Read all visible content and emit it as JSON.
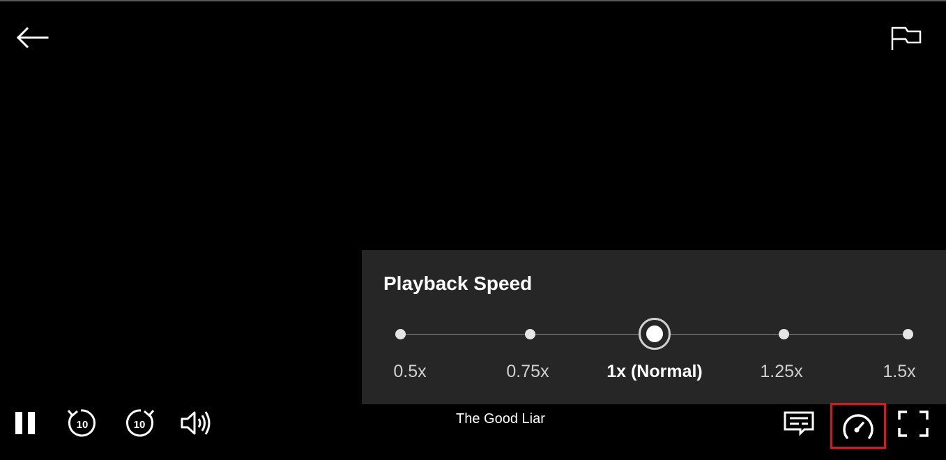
{
  "player": {
    "title": "The Good Liar"
  },
  "top_bar": {
    "back_icon": "arrow-left-icon",
    "report_icon": "flag-icon"
  },
  "speed_panel": {
    "title": "Playback Speed",
    "options": [
      {
        "label": "0.5x",
        "selected": false
      },
      {
        "label": "0.75x",
        "selected": false
      },
      {
        "label": "1x (Normal)",
        "selected": true
      },
      {
        "label": "1.25x",
        "selected": false
      },
      {
        "label": "1.5x",
        "selected": false
      }
    ]
  },
  "controls": {
    "pause_icon": "pause-icon",
    "rewind_icon": "rewind-10-icon",
    "rewind_seconds": "10",
    "forward_icon": "forward-10-icon",
    "forward_seconds": "10",
    "volume_icon": "volume-icon",
    "subtitles_icon": "subtitles-icon",
    "speed_icon": "speedometer-icon",
    "fullscreen_icon": "fullscreen-icon"
  },
  "colors": {
    "background": "#000000",
    "panel_background": "#262626",
    "highlight_border": "#e0141f",
    "text": "#ffffff",
    "muted_text": "#d0d0d0"
  }
}
